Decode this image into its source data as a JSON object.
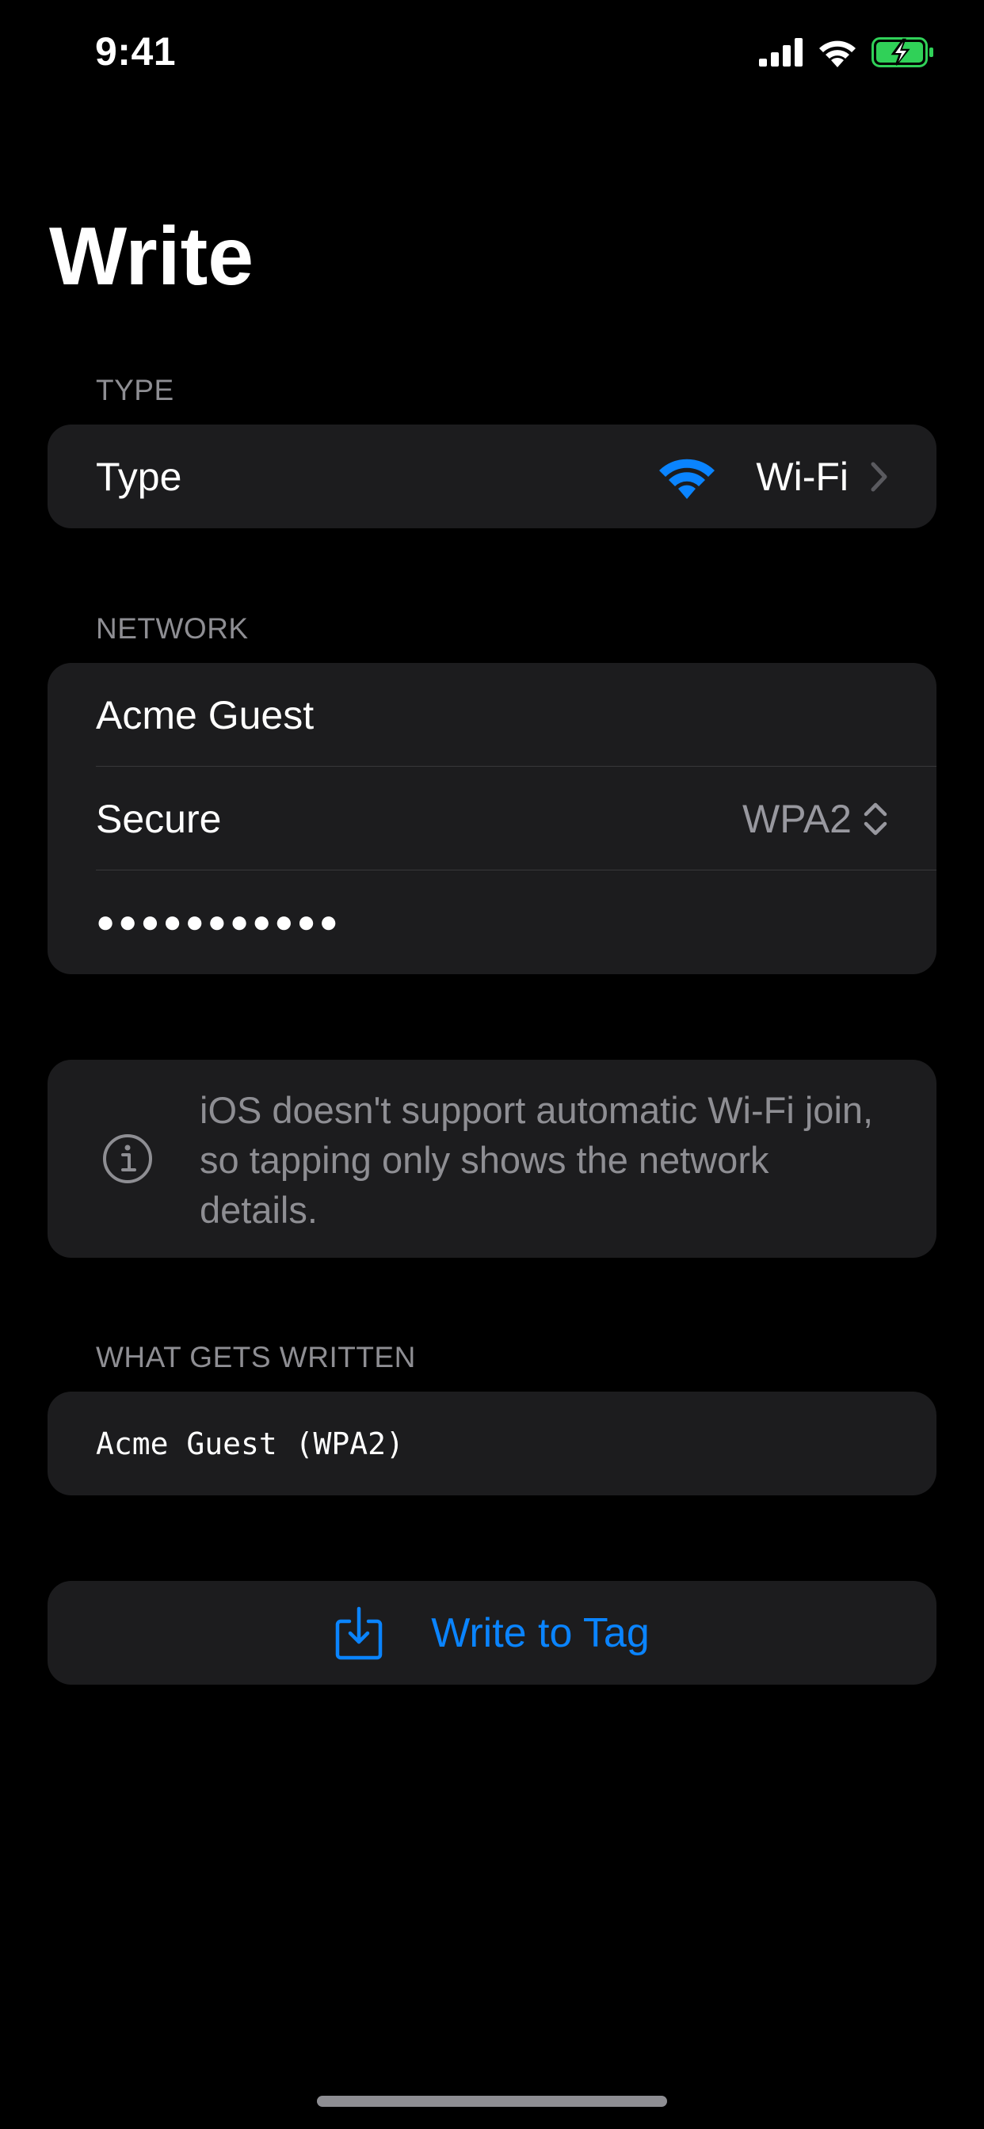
{
  "status_bar": {
    "time": "9:41",
    "icons": [
      "cellular-signal-icon",
      "wifi-icon",
      "battery-charging-icon"
    ]
  },
  "page": {
    "title": "Write"
  },
  "type_section": {
    "header": "TYPE",
    "row_label": "Type",
    "icon": "wifi-icon",
    "value": "Wi-Fi"
  },
  "network_section": {
    "header": "NETWORK",
    "ssid_value": "Acme Guest",
    "security_label": "Secure",
    "security_value": "WPA2",
    "password_masked": "●●●●●●●●●●●"
  },
  "info": {
    "icon": "info-circle-icon",
    "text": "iOS doesn't support automatic Wi-Fi join, so tapping only shows the network details."
  },
  "preview_section": {
    "header": "WHAT GETS WRITTEN",
    "value": "Acme Guest (WPA2)"
  },
  "actions": {
    "write_icon": "tray-download-icon",
    "write_label": "Write to Tag"
  },
  "colors": {
    "accent": "#0a84ff",
    "background": "#000000",
    "card": "#1c1c1e",
    "secondary_text": "#8e8e93",
    "battery_charging": "#30d158"
  }
}
